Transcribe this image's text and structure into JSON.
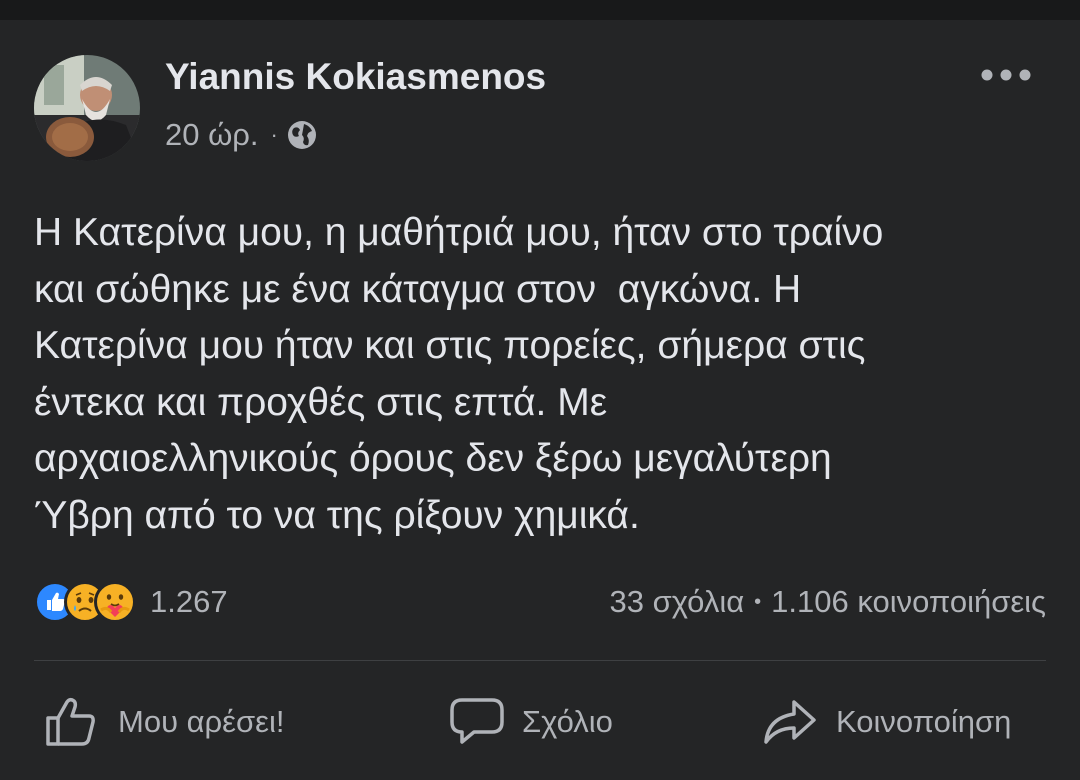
{
  "post": {
    "author": "Yiannis Kokiasmenos",
    "time": "20 ώρ.",
    "separator": "·",
    "privacy_icon": "globe-icon",
    "text_lines": [
      "Η Κατερίνα μου, η μαθήτριά μου, ήταν στο τραίνο",
      "και σώθηκε με ένα κάταγμα στον  αγκώνα. Η",
      "Κατερίνα μου ήταν και στις πορείες, σήμερα στις",
      "έντεκα και προχθές στις επτά. Με",
      "αρχαιοελληνικούς όρους δεν ξέρω μεγαλύτερη",
      "Ύβρη από το να της ρίξουν χημικά."
    ]
  },
  "reactions": {
    "icons": [
      "like-reaction-icon",
      "sad-reaction-icon",
      "care-reaction-icon"
    ],
    "count": "1.267",
    "comments": "33 σχόλια",
    "dot": "•",
    "shares": "1.106 κοινοποιήσεις"
  },
  "actions": {
    "like": "Μου αρέσει!",
    "comment": "Σχόλιο",
    "share": "Κοινοποίηση"
  },
  "colors": {
    "background": "#242526",
    "top_strip": "#18191a",
    "primary_text": "#e4e6eb",
    "secondary_text": "#b0b3b8",
    "like_blue": "#2d88ff",
    "divider": "#3e4042"
  }
}
